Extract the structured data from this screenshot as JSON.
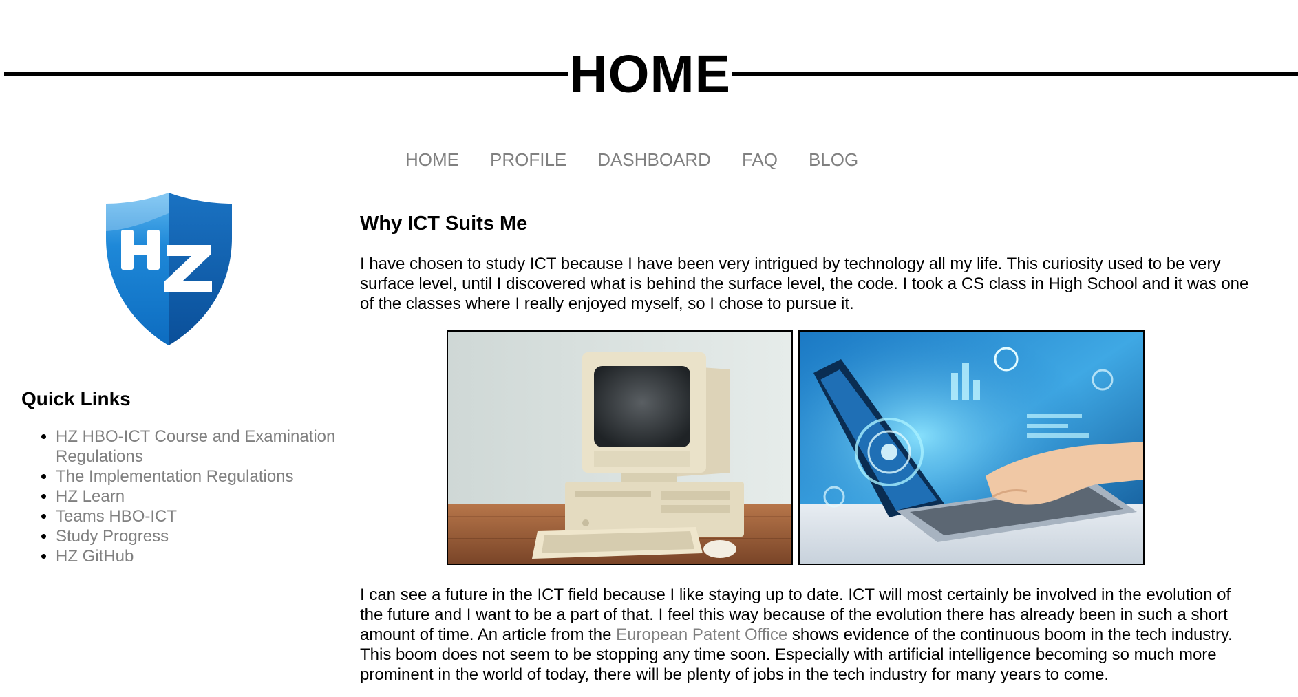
{
  "header": {
    "title": "HOME"
  },
  "nav": {
    "items": [
      {
        "label": "HOME"
      },
      {
        "label": "PROFILE"
      },
      {
        "label": "DASHBOARD"
      },
      {
        "label": "FAQ"
      },
      {
        "label": "BLOG"
      }
    ]
  },
  "logo": {
    "text": "HZ",
    "colors": {
      "shield_light": "#2a8fd6",
      "shield_dark": "#0b5ea8",
      "letters": "#ffffff"
    }
  },
  "sidebar": {
    "quick_links_title": "Quick Links",
    "links": [
      {
        "label": "HZ HBO-ICT Course and Examination Regulations"
      },
      {
        "label": "The Implementation Regulations"
      },
      {
        "label": "HZ Learn"
      },
      {
        "label": "Teams HBO-ICT"
      },
      {
        "label": "Study Progress"
      },
      {
        "label": "HZ GitHub"
      }
    ]
  },
  "main": {
    "heading": "Why ICT Suits Me",
    "intro": "I have chosen to study ICT because I have been very intrigued by technology all my life. This curiosity used to be very surface level, until I discovered what is behind the surface level, the code. I took a CS class in High School and it was one of the classes where I really enjoyed myself, so I chose to pursue it.",
    "outro_before_link": "I can see a future in the ICT field because I like staying up to date. ICT will most certainly be involved in the evolution of the future and I want to be a part of that. I feel this way because of the evolution there has already been in such a short amount of time. An article from the ",
    "outro_link": "European Patent Office",
    "outro_after_link": " shows evidence of the continuous boom in the tech industry. This boom does not seem to be stopping any time soon. Especially with artificial intelligence becoming so much more prominent in the world of today, there will be plenty of jobs in the tech industry for many years to come."
  },
  "images": [
    {
      "subject": "old-desktop-computer"
    },
    {
      "subject": "laptop-with-holographic-tech"
    }
  ],
  "colors": {
    "link_gray": "#808080",
    "text": "#000000",
    "background": "#ffffff"
  }
}
